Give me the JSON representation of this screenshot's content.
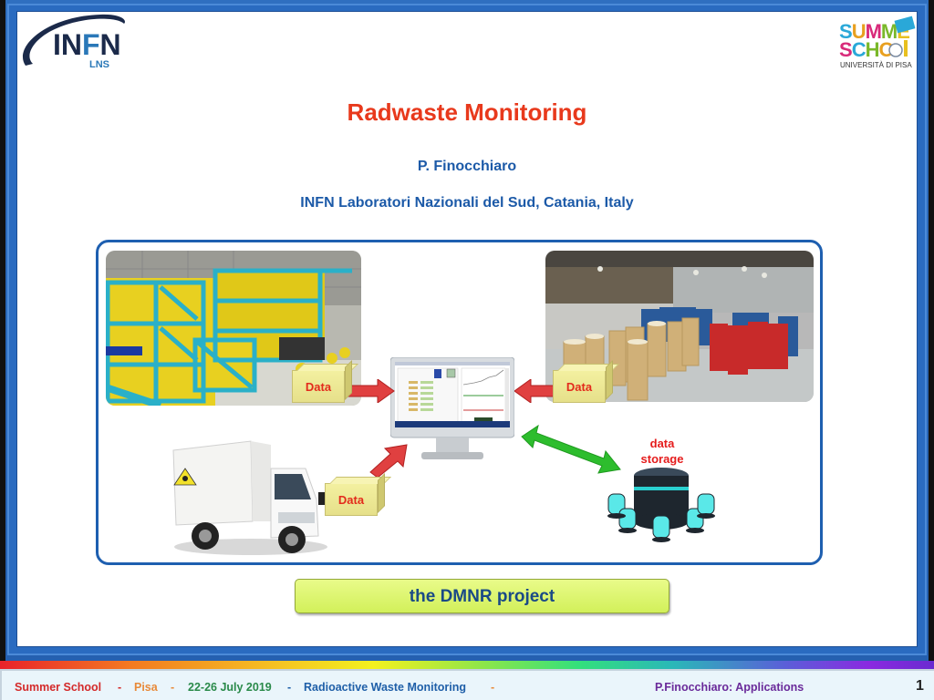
{
  "header": {
    "logo_left": {
      "name": "INFN",
      "sub": "LNS"
    },
    "logo_right": {
      "line1": "SUMMER",
      "line2": "SCHOOL",
      "line3": "UNIVERSITÀ DI PISA"
    }
  },
  "slide": {
    "title": "Radwaste Monitoring",
    "author": "P. Finocchiaro",
    "affiliation": "INFN Laboratori Nazionali del Sud, Catania, Italy",
    "diagram": {
      "data_labels": [
        "Data",
        "Data",
        "Data"
      ],
      "storage_label_line1": "data",
      "storage_label_line2": "storage",
      "images": [
        "radwaste-warehouse-yellow-drums",
        "radwaste-storage-hall-drums",
        "radioactive-transport-truck",
        "monitoring-computer",
        "data-storage-server"
      ]
    },
    "project_button": "the DMNR project"
  },
  "footer": {
    "event": "Summer School",
    "sep": "-",
    "place": "Pisa",
    "dates": "22-26 July 2019",
    "topic": "Radioactive Waste Monitoring",
    "speaker": "P.Finocchiaro: Applications",
    "page": "1",
    "colors": {
      "event": "#d42a2a",
      "place": "#e88a3a",
      "dates": "#2a8a4a",
      "topic": "#1f5fa8",
      "speaker": "#6a2a9a",
      "page": "#222222"
    }
  }
}
